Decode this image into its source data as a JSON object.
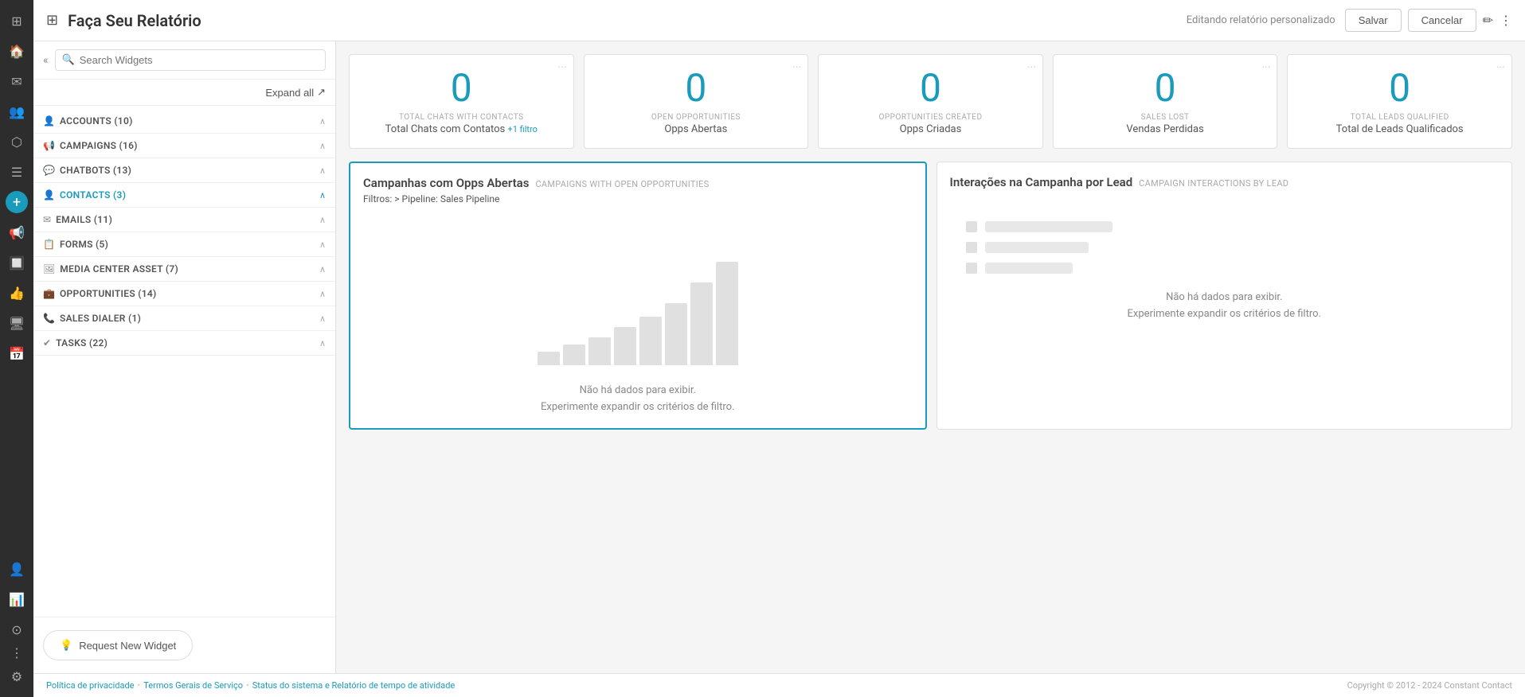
{
  "app": {
    "title": "Faça Seu Relatório",
    "editing_label": "Editando relatório personalizado"
  },
  "header": {
    "save_label": "Salvar",
    "cancel_label": "Cancelar"
  },
  "sidebar": {
    "search_placeholder": "Search Widgets",
    "expand_all_label": "Expand all",
    "categories": [
      {
        "id": "accounts",
        "name": "ACCOUNTS (10)",
        "icon": "👤",
        "expanded": true
      },
      {
        "id": "campaigns",
        "name": "CAMPAIGNS (16)",
        "icon": "📢",
        "expanded": true
      },
      {
        "id": "chatbots",
        "name": "CHATBOTS (13)",
        "icon": "💬",
        "expanded": true
      },
      {
        "id": "contacts",
        "name": "CONTACTS (3)",
        "icon": "👤",
        "expanded": true,
        "active": true
      },
      {
        "id": "emails",
        "name": "EMAILS (11)",
        "icon": "✉",
        "expanded": true
      },
      {
        "id": "forms",
        "name": "FORMS (5)",
        "icon": "📋",
        "expanded": true
      },
      {
        "id": "media_center",
        "name": "MEDIA CENTER ASSET (7)",
        "icon": "🖼",
        "expanded": true
      },
      {
        "id": "opportunities",
        "name": "OPPORTUNITIES (14)",
        "icon": "💼",
        "expanded": true
      },
      {
        "id": "sales_dialer",
        "name": "SALES DIALER (1)",
        "icon": "📞",
        "expanded": true
      },
      {
        "id": "tasks",
        "name": "TASKS (22)",
        "icon": "✔",
        "expanded": true
      }
    ],
    "request_widget_label": "Request New Widget"
  },
  "stat_cards": [
    {
      "value": "0",
      "label_en": "TOTAL CHATS WITH CONTACTS",
      "label_pt": "Total Chats com Contatos",
      "filter": "+1 filtro"
    },
    {
      "value": "0",
      "label_en": "OPEN OPPORTUNITIES",
      "label_pt": "Opps Abertas",
      "filter": null
    },
    {
      "value": "0",
      "label_en": "OPPORTUNITIES CREATED",
      "label_pt": "Opps Criadas",
      "filter": null
    },
    {
      "value": "0",
      "label_en": "SALES LOST",
      "label_pt": "Vendas Perdidas",
      "filter": null
    },
    {
      "value": "0",
      "label_en": "TOTAL LEADS QUALIFIED",
      "label_pt": "Total de Leads Qualificados",
      "filter": null
    }
  ],
  "chart_main": {
    "title_pt": "Campanhas com Opps Abertas",
    "title_en": "CAMPAIGNS WITH OPEN OPPORTUNITIES",
    "filter_label": "Filtros:",
    "filter_value": "> Pipeline: Sales Pipeline",
    "no_data_line1": "Não há dados para exibir.",
    "no_data_line2": "Experimente expandir os critérios de filtro.",
    "bars": [
      20,
      30,
      40,
      55,
      70,
      90,
      120,
      150
    ]
  },
  "chart_side": {
    "title_pt": "Interações na Campanha por Lead",
    "title_en": "CAMPAIGN INTERACTIONS BY LEAD",
    "no_data_line1": "Não há dados para exibir.",
    "no_data_line2": "Experimente expandir os critérios de filtro.",
    "skeleton_bars": [
      120,
      90,
      80
    ]
  },
  "footer": {
    "privacy_link": "Política de privacidade",
    "terms_link": "Termos Gerais de Serviço",
    "status_link": "Status do sistema e Relatório de tempo de atividade",
    "copyright": "Copyright © 2012 - 2024 Constant Contact"
  }
}
